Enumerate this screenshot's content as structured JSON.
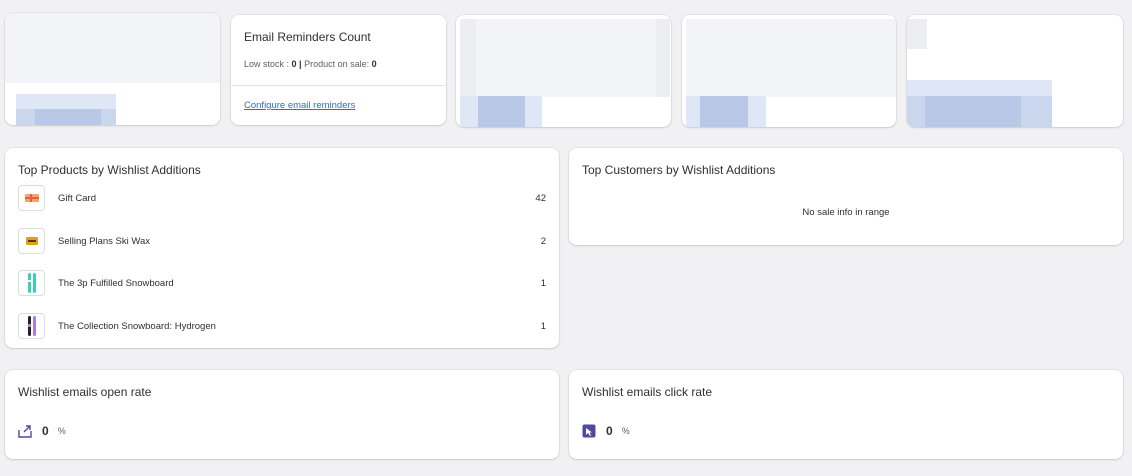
{
  "email_reminders_card": {
    "title": "Email Reminders Count",
    "low_stock_label": "Low stock : ",
    "low_stock_value": "0",
    "separator": " | ",
    "on_sale_label": "Product on sale: ",
    "on_sale_value": "0",
    "configure_link": "Configure email reminders"
  },
  "top_products": {
    "title": "Top Products by Wishlist Additions",
    "items": [
      {
        "name": "Gift Card",
        "count": "42"
      },
      {
        "name": "Selling Plans Ski Wax",
        "count": "2"
      },
      {
        "name": "The 3p Fulfilled Snowboard",
        "count": "1"
      },
      {
        "name": "The Collection Snowboard: Hydrogen",
        "count": "1"
      }
    ]
  },
  "top_customers": {
    "title": "Top Customers by Wishlist Additions",
    "empty_message": "No sale info in range"
  },
  "open_rate": {
    "title": "Wishlist emails open rate",
    "value": "0",
    "unit": "%"
  },
  "click_rate": {
    "title": "Wishlist emails click rate",
    "value": "0",
    "unit": "%"
  },
  "colors": {
    "link": "#2c6ecb",
    "icon_purple": "#4f4a9c",
    "background": "#f1f1f3"
  }
}
